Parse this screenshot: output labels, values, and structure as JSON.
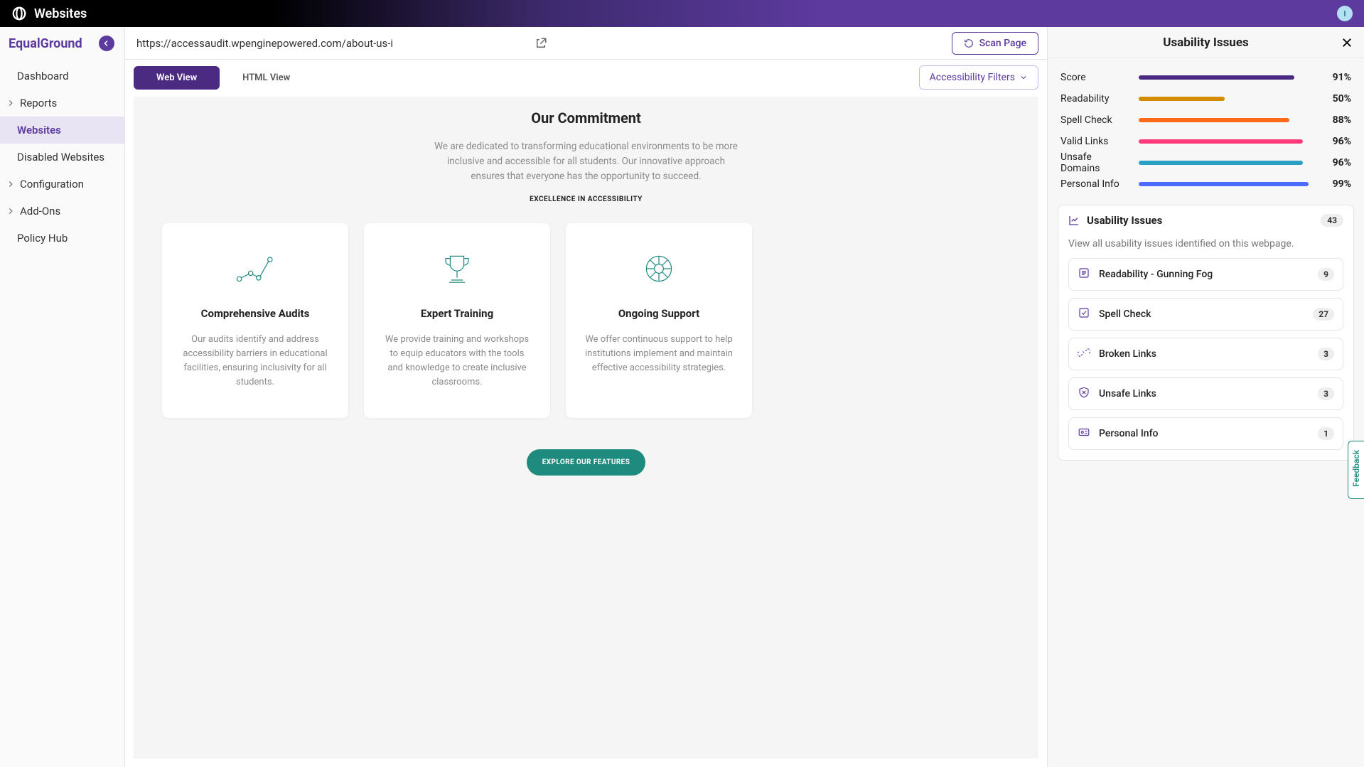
{
  "topbar": {
    "brand": "Websites",
    "avatar_initial": "I"
  },
  "sidebar": {
    "site_name": "EqualGround",
    "items": [
      {
        "label": "Dashboard",
        "has_chevron": false,
        "active": false
      },
      {
        "label": "Reports",
        "has_chevron": true,
        "active": false
      },
      {
        "label": "Websites",
        "has_chevron": false,
        "active": true
      },
      {
        "label": "Disabled Websites",
        "has_chevron": false,
        "active": false
      },
      {
        "label": "Configuration",
        "has_chevron": true,
        "active": false
      },
      {
        "label": "Add-Ons",
        "has_chevron": true,
        "active": false
      },
      {
        "label": "Policy Hub",
        "has_chevron": false,
        "active": false
      }
    ]
  },
  "urlbar": {
    "value": "https://accessaudit.wpenginepowered.com/about-us-i",
    "scan_label": "Scan Page"
  },
  "view": {
    "tabs": [
      {
        "label": "Web View",
        "active": true
      },
      {
        "label": "HTML View",
        "active": false
      }
    ],
    "filters_label": "Accessibility Filters"
  },
  "preview": {
    "commitment_title": "Our Commitment",
    "commitment_text": "We are dedicated to transforming educational environments to be more inclusive and accessible for all students. Our innovative approach ensures that everyone has the opportunity to succeed.",
    "excellence_label": "EXCELLENCE IN ACCESSIBILITY",
    "cards": [
      {
        "title": "Comprehensive Audits",
        "desc": "Our audits identify and address accessibility barriers in educational facilities, ensuring inclusivity for all students."
      },
      {
        "title": "Expert Training",
        "desc": "We provide training and workshops to equip educators with the tools and knowledge to create inclusive classrooms."
      },
      {
        "title": "Ongoing Support",
        "desc": "We offer continuous support to help institutions implement and maintain effective accessibility strategies."
      }
    ],
    "explore_label": "EXPLORE OUR FEATURES"
  },
  "panel": {
    "title": "Usability Issues",
    "metrics": [
      {
        "label": "Score",
        "value": "91%",
        "pct": 91,
        "color": "#4b2b82"
      },
      {
        "label": "Readability",
        "value": "50%",
        "pct": 50,
        "color": "#d38b00"
      },
      {
        "label": "Spell Check",
        "value": "88%",
        "pct": 88,
        "color": "#ff6a1a"
      },
      {
        "label": "Valid Links",
        "value": "96%",
        "pct": 96,
        "color": "#ff3b7b"
      },
      {
        "label": "Unsafe Domains",
        "value": "96%",
        "pct": 96,
        "color": "#2aa0c4"
      },
      {
        "label": "Personal Info",
        "value": "99%",
        "pct": 99,
        "color": "#4a6cff"
      }
    ],
    "issues_header": "Usability Issues",
    "issues_total": "43",
    "issues_desc": "View all usability issues identified on this webpage.",
    "issues": [
      {
        "label": "Readability - Gunning Fog",
        "count": "9",
        "icon": "doc"
      },
      {
        "label": "Spell Check",
        "count": "27",
        "icon": "check"
      },
      {
        "label": "Broken Links",
        "count": "3",
        "icon": "broken"
      },
      {
        "label": "Unsafe Links",
        "count": "3",
        "icon": "shield"
      },
      {
        "label": "Personal Info",
        "count": "1",
        "icon": "id"
      }
    ]
  },
  "feedback_label": "Feedback"
}
